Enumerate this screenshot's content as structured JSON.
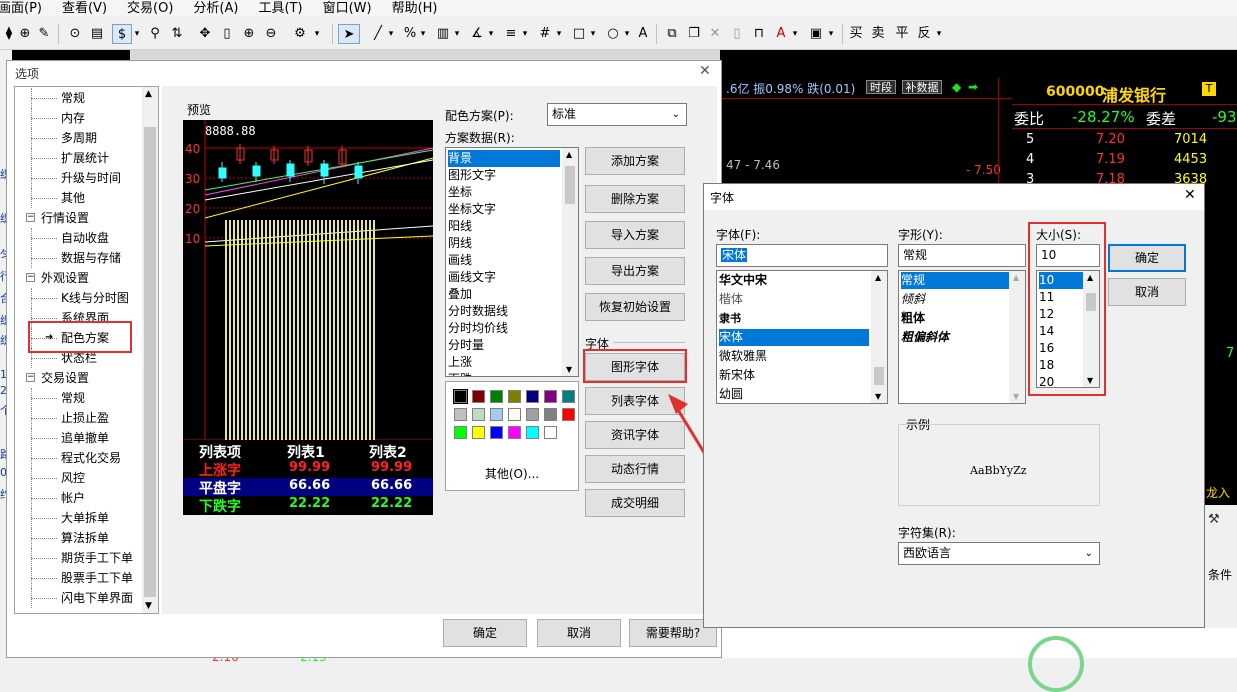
{
  "menu": [
    "画面(P)",
    "查看(V)",
    "交易(O)",
    "分析(A)",
    "工具(T)",
    "窗口(W)",
    "帮助(H)"
  ],
  "toolbar": {
    "items": [
      "$",
      "%",
      "A",
      "买",
      "卖",
      "平",
      "反"
    ]
  },
  "background": {
    "stats_line": ".6亿  振0.98%  跌(0.01)",
    "tag_shiduan": "时段",
    "tag_bushuju": "补数据",
    "range_text": "47 - 7.46",
    "price_mark": "- 7.50",
    "stock_code": "600000",
    "stock_name": "浦发银行",
    "weibi_label": "委比",
    "weibi_value": "-28.27%",
    "weicha_label": "委差",
    "weicha_value": "-93",
    "rows": [
      {
        "n": "5",
        "price": "7.20",
        "vol": "7014"
      },
      {
        "n": "4",
        "price": "7.19",
        "vol": "4453"
      },
      {
        "n": "3",
        "price": "7.18",
        "vol": "3638"
      }
    ],
    "bottom_left": [
      "2.16",
      "2.15"
    ],
    "right_bottom_1": "龙入",
    "right_bottom_2": "条件",
    "right_val": "7",
    "left_edge_chars": [
      "织",
      "织",
      "匀",
      "行",
      "合",
      "织",
      "织",
      "1",
      "2",
      "个",
      "路",
      "08",
      "约"
    ]
  },
  "options_dialog": {
    "title": "选项",
    "tree": [
      {
        "label": "常规",
        "level": 2
      },
      {
        "label": "内存",
        "level": 2
      },
      {
        "label": "多周期",
        "level": 2
      },
      {
        "label": "扩展统计",
        "level": 2
      },
      {
        "label": "升级与时间",
        "level": 2
      },
      {
        "label": "其他",
        "level": 2
      },
      {
        "label": "行情设置",
        "level": 1
      },
      {
        "label": "自动收盘",
        "level": 2
      },
      {
        "label": "数据与存储",
        "level": 2
      },
      {
        "label": "外观设置",
        "level": 1
      },
      {
        "label": "K线与分时图",
        "level": 2
      },
      {
        "label": "系统界面",
        "level": 2
      },
      {
        "label": "配色方案",
        "level": 2
      },
      {
        "label": "状态栏",
        "level": 2
      },
      {
        "label": "交易设置",
        "level": 1
      },
      {
        "label": "常规",
        "level": 2
      },
      {
        "label": "止损止盈",
        "level": 2
      },
      {
        "label": "追单撤单",
        "level": 2
      },
      {
        "label": "程式化交易",
        "level": 2
      },
      {
        "label": "风控",
        "level": 2
      },
      {
        "label": "帐户",
        "level": 2
      },
      {
        "label": "大单拆单",
        "level": 2
      },
      {
        "label": "算法拆单",
        "level": 2
      },
      {
        "label": "期货手工下单",
        "level": 2
      },
      {
        "label": "股票手工下单",
        "level": 2
      },
      {
        "label": "闪电下单界面",
        "level": 2
      }
    ],
    "preview_label": "预览",
    "preview_price": "8888.88",
    "preview_axis": [
      "40",
      "30",
      "20",
      "10"
    ],
    "legend_header": [
      "列表项",
      "列表1",
      "列表2"
    ],
    "legend_rows": [
      {
        "label": "上涨字",
        "v1": "99.99",
        "v2": "99.99",
        "color": "#ff2020"
      },
      {
        "label": "平盘字",
        "v1": "66.66",
        "v2": "66.66",
        "color": "#ffffff"
      },
      {
        "label": "下跌字",
        "v1": "22.22",
        "v2": "22.22",
        "color": "#20ff20"
      }
    ],
    "scheme_label": "配色方案(P):",
    "scheme_value": "标准",
    "scheme_data_label": "方案数据(R):",
    "scheme_items": [
      "背景",
      "图形文字",
      "坐标",
      "坐标文字",
      "阳线",
      "阴线",
      "画线",
      "画线文字",
      "叠加",
      "分时数据线",
      "分时均价线",
      "分时量",
      "上涨",
      "下跌"
    ],
    "colors": [
      "#000000",
      "#800000",
      "#008000",
      "#808000",
      "#000080",
      "#800080",
      "#008080",
      "#c0c0c0",
      "#c0dcc0",
      "#a6caf0",
      "#fffbf0",
      "#a0a0a4",
      "#808080",
      "#ff0000",
      "#00ff00",
      "#ffff00",
      "#0000ff",
      "#ff00ff",
      "#00ffff",
      "#ffffff"
    ],
    "other_label": "其他(O)...",
    "buttons_right": [
      "添加方案",
      "删除方案",
      "导入方案",
      "导出方案",
      "恢复初始设置"
    ],
    "font_group_label": "字体",
    "font_buttons": [
      "图形字体",
      "列表字体",
      "资讯字体",
      "动态行情",
      "成交明细"
    ],
    "ok": "确定",
    "cancel": "取消",
    "help": "需要帮助?"
  },
  "font_dialog": {
    "title": "字体",
    "font_label": "字体(F):",
    "font_value": "宋体",
    "fonts": [
      "华文中宋",
      "楷体",
      "隶书",
      "宋体",
      "微软雅黑",
      "新宋体",
      "幼圆"
    ],
    "style_label": "字形(Y):",
    "style_value": "常规",
    "styles": [
      "常规",
      "倾斜",
      "粗体",
      "粗偏斜体"
    ],
    "size_label": "大小(S):",
    "size_value": "10",
    "sizes": [
      "10",
      "11",
      "12",
      "14",
      "16",
      "18",
      "20"
    ],
    "ok": "确定",
    "cancel": "取消",
    "sample_label": "示例",
    "sample_text": "AaBbYyZz",
    "charset_label": "字符集(R):",
    "charset_value": "西欧语言"
  }
}
